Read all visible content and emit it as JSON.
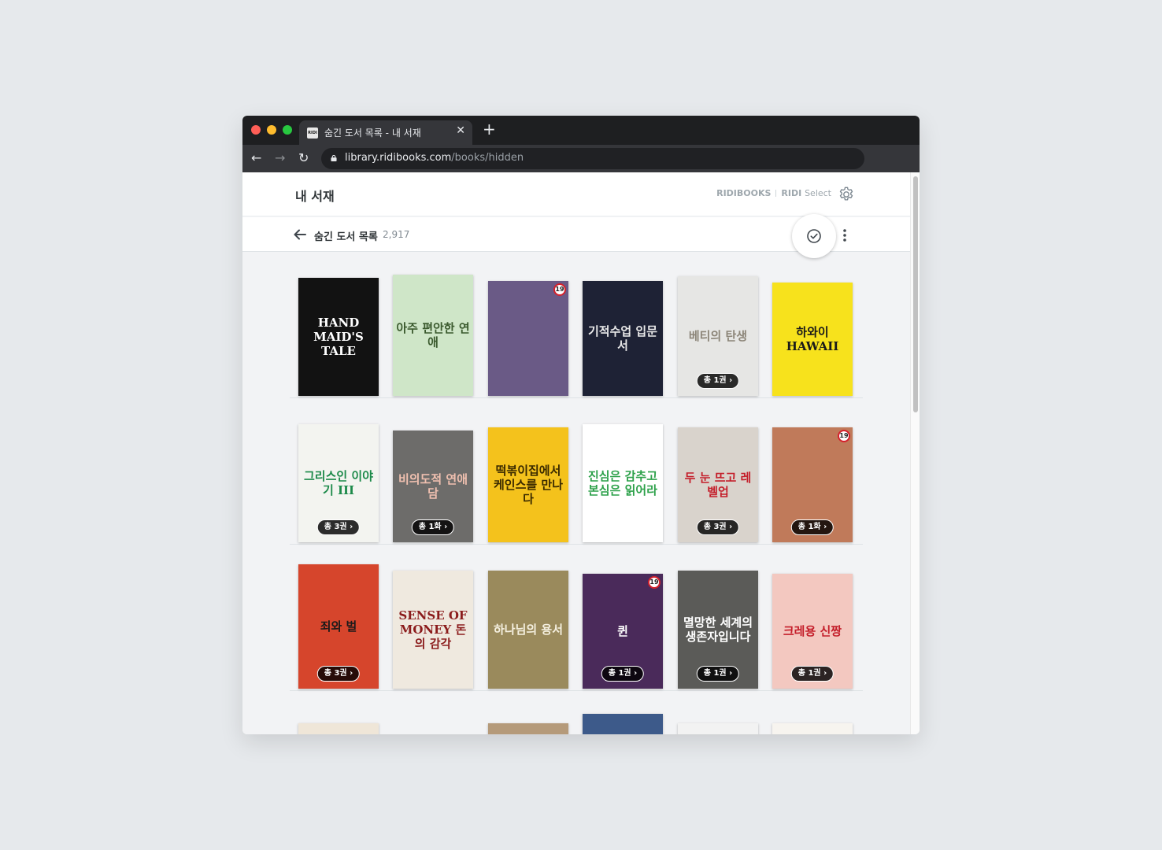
{
  "browser": {
    "tab_title": "숨긴 도서 목록 - 내 서재",
    "favicon_text": "RIDI",
    "url_host": "library.ridibooks.com",
    "url_path": "/books/hidden"
  },
  "header": {
    "title": "내 서재",
    "brand_ridibooks": "RIDIBOOKS",
    "brand_ridi": "RIDI",
    "brand_select": "Select"
  },
  "subheader": {
    "title": "숨긴 도서 목록",
    "count": "2,917"
  },
  "books": [
    {
      "title": "HAND MAID'S TALE",
      "bg": "#121212",
      "fg": "#ffffff",
      "pill": "",
      "adult": false
    },
    {
      "title": "아주 편안한 연애",
      "bg": "#cfe6c8",
      "fg": "#3b5a2e",
      "pill": "",
      "adult": false
    },
    {
      "title": "",
      "bg": "#6a5a86",
      "fg": "#ffffff",
      "pill": "",
      "adult": true
    },
    {
      "title": "기적수업 입문서",
      "bg": "#1e2235",
      "fg": "#e9e9e9",
      "pill": "",
      "adult": false
    },
    {
      "title": "베티의 탄생",
      "bg": "#e6e6e4",
      "fg": "#8c8578",
      "pill": "총 1권",
      "adult": false
    },
    {
      "title": "하와이 HAWAII",
      "bg": "#f7e21c",
      "fg": "#1a1a1a",
      "pill": "",
      "adult": false
    },
    {
      "title": "그리스인 이야기 III",
      "bg": "#f3f4f0",
      "fg": "#1d8a4a",
      "pill": "총 3권",
      "adult": false
    },
    {
      "title": "비의도적 연애담",
      "bg": "#6d6c6a",
      "fg": "#f0c0b0",
      "pill": "총 1화",
      "adult": false
    },
    {
      "title": "떡볶이집에서 케인스를 만나다",
      "bg": "#f4c21c",
      "fg": "#3a2a00",
      "pill": "",
      "adult": false
    },
    {
      "title": "진심은 감추고 본심은 읽어라",
      "bg": "#ffffff",
      "fg": "#2da14a",
      "pill": "",
      "adult": false
    },
    {
      "title": "두 눈 뜨고 레벨업",
      "bg": "#d9d3cc",
      "fg": "#c41e2a",
      "pill": "총 3권",
      "adult": false
    },
    {
      "title": "",
      "bg": "#c07a5a",
      "fg": "#ffffff",
      "pill": "총 1화",
      "adult": true
    },
    {
      "title": "죄와 벌",
      "bg": "#d6452c",
      "fg": "#1a1a1a",
      "pill": "총 3권",
      "adult": false
    },
    {
      "title": "SENSE OF MONEY 돈의 감각",
      "bg": "#efe9df",
      "fg": "#8b1c1c",
      "pill": "",
      "adult": false
    },
    {
      "title": "하나님의 용서",
      "bg": "#9a8a5c",
      "fg": "#f5f0e0",
      "pill": "",
      "adult": false
    },
    {
      "title": "퀸",
      "bg": "#4a2a5a",
      "fg": "#ffffff",
      "pill": "총 1권",
      "adult": true
    },
    {
      "title": "멸망한 세계의 생존자입니다",
      "bg": "#5b5b58",
      "fg": "#ffffff",
      "pill": "총 1권",
      "adult": false
    },
    {
      "title": "크레용 신짱",
      "bg": "#f3c8c0",
      "fg": "#c41e2a",
      "pill": "총 1권",
      "adult": false
    }
  ],
  "colors": {
    "accent": "#1f8ce6",
    "adult_badge_ring": "#d4212c"
  },
  "icons": {
    "gear": "gear-icon",
    "back": "arrow-left-icon",
    "select": "check-circle-icon",
    "more": "more-vertical-icon"
  },
  "adult_badge_text": "19"
}
